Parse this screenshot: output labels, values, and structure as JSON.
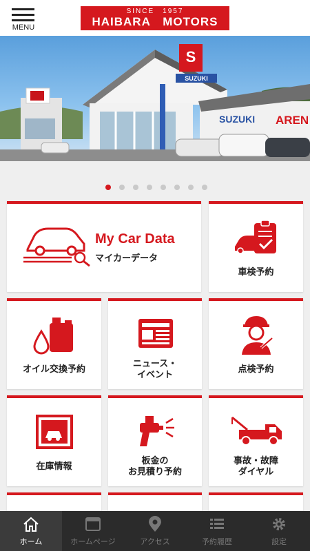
{
  "header": {
    "menu_label": "MENU",
    "logo_since": "SINCE　1957",
    "logo_name": "HAIBARA　MOTORS"
  },
  "hero": {
    "sign_brand": "SUZUKI",
    "sign_arena": "AREN",
    "slide_count": 8,
    "active_slide": 1
  },
  "tiles": {
    "my_car_data_title": "My Car Data",
    "my_car_data_sub": "マイカーデータ",
    "inspection_reservation": "車検予約",
    "oil_change": "オイル交換予約",
    "news_line1": "ニュース・",
    "news_line2": "イベント",
    "checkup": "点検予約",
    "inventory": "在庫情報",
    "bodywork_line1": "板金の",
    "bodywork_line2": "お見積り予約",
    "accident_line1": "事故・故障",
    "accident_line2": "ダイヤル"
  },
  "bottom_nav": {
    "home": "ホーム",
    "homepage": "ホームページ",
    "access": "アクセス",
    "history": "予約履歴",
    "settings": "設定"
  },
  "colors": {
    "accent": "#d5181e",
    "nav_bg": "#2b2b2b"
  }
}
